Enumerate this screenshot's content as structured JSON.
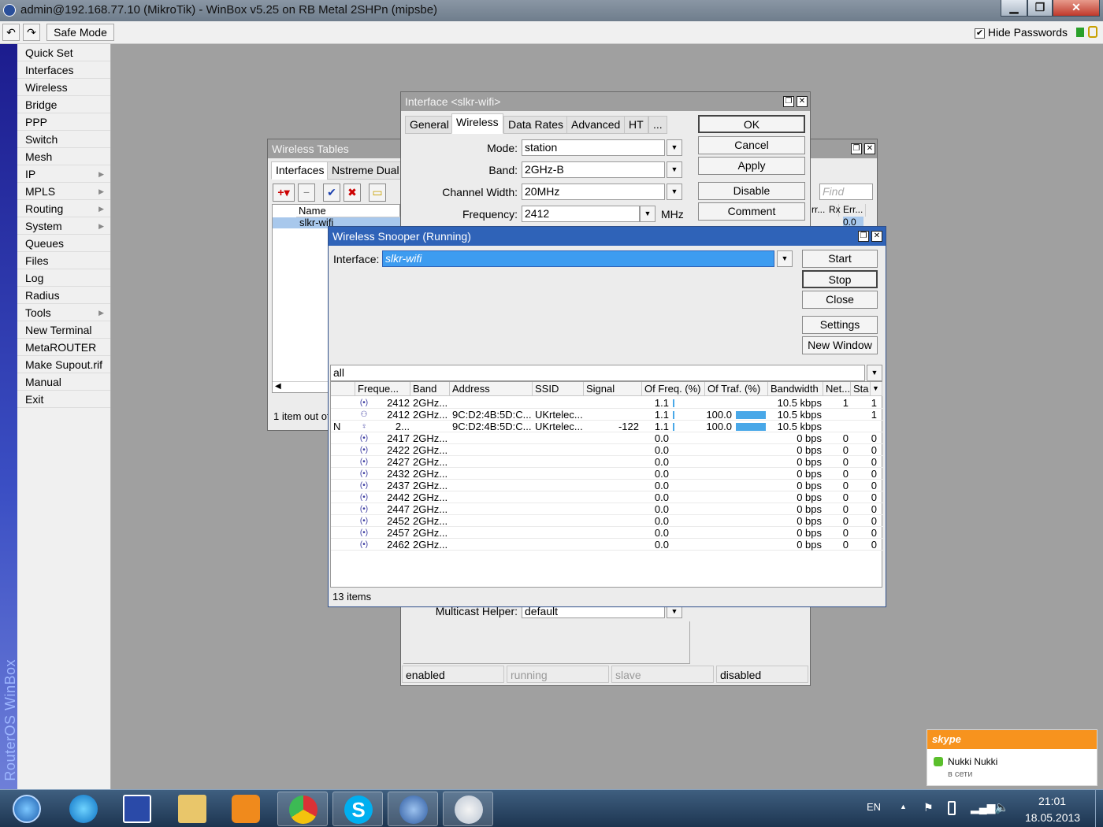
{
  "window": {
    "title": "admin@192.168.77.10 (MikroTik) - WinBox v5.25 on RB Metal 2SHPn (mipsbe)",
    "min_glyph": "▁",
    "max_glyph": "❐",
    "close_glyph": "✕"
  },
  "toolbar": {
    "undo_glyph": "↶",
    "redo_glyph": "↷",
    "safe_mode_label": "Safe Mode",
    "hide_passwords_label": "Hide Passwords",
    "hide_passwords_checked": "✔"
  },
  "sidebar": {
    "brand": "RouterOS WinBox",
    "items": [
      {
        "label": "Quick Set",
        "arrow": ""
      },
      {
        "label": "Interfaces",
        "arrow": ""
      },
      {
        "label": "Wireless",
        "arrow": ""
      },
      {
        "label": "Bridge",
        "arrow": ""
      },
      {
        "label": "PPP",
        "arrow": ""
      },
      {
        "label": "Switch",
        "arrow": ""
      },
      {
        "label": "Mesh",
        "arrow": ""
      },
      {
        "label": "IP",
        "arrow": "▶"
      },
      {
        "label": "MPLS",
        "arrow": "▶"
      },
      {
        "label": "Routing",
        "arrow": "▶"
      },
      {
        "label": "System",
        "arrow": "▶"
      },
      {
        "label": "Queues",
        "arrow": ""
      },
      {
        "label": "Files",
        "arrow": ""
      },
      {
        "label": "Log",
        "arrow": ""
      },
      {
        "label": "Radius",
        "arrow": ""
      },
      {
        "label": "Tools",
        "arrow": "▶"
      },
      {
        "label": "New Terminal",
        "arrow": ""
      },
      {
        "label": "MetaROUTER",
        "arrow": ""
      },
      {
        "label": "Make Supout.rif",
        "arrow": ""
      },
      {
        "label": "Manual",
        "arrow": ""
      },
      {
        "label": "Exit",
        "arrow": ""
      }
    ]
  },
  "wireless_tables": {
    "title": "Wireless Tables",
    "tabs": [
      "Interfaces",
      "Nstreme Dual"
    ],
    "col_name": "Name",
    "row_name": "slkr-wifi",
    "find_placeholder": "Find",
    "col_rr": "rr...",
    "col_rx_err": "Rx Err...",
    "col_value": "0.0",
    "status": "1 item out of"
  },
  "interface_dialog": {
    "title": "Interface <slkr-wifi>",
    "tabs": [
      "General",
      "Wireless",
      "Data Rates",
      "Advanced",
      "HT",
      "..."
    ],
    "active_tab": "Wireless",
    "fields": {
      "mode_label": "Mode:",
      "mode_value": "station",
      "band_label": "Band:",
      "band_value": "2GHz-B",
      "channel_width_label": "Channel Width:",
      "channel_width_value": "20MHz",
      "frequency_label": "Frequency:",
      "frequency_value": "2412",
      "frequency_unit": "MHz",
      "multicast_label": "Multicast Helper:",
      "multicast_value": "default"
    },
    "buttons": {
      "ok": "OK",
      "cancel": "Cancel",
      "apply": "Apply",
      "disable": "Disable",
      "comment": "Comment"
    },
    "status": {
      "enabled": "enabled",
      "running": "running",
      "slave": "slave",
      "disabled": "disabled"
    }
  },
  "snooper": {
    "title": "Wireless Snooper (Running)",
    "interface_label": "Interface:",
    "interface_value": "slkr-wifi",
    "filter_value": "all",
    "buttons": {
      "start": "Start",
      "stop": "Stop",
      "close": "Close",
      "settings": "Settings",
      "new_window": "New Window"
    },
    "columns": [
      "Freque...",
      "Band",
      "Address",
      "SSID",
      "Signal",
      "Of Freq. (%)",
      "Of Traf. (%)",
      "Bandwidth",
      "Net...",
      "Sta"
    ],
    "rows": [
      {
        "flag": "",
        "icon": "(•)",
        "freq": "2412",
        "band": "2GHz...",
        "address": "",
        "ssid": "",
        "signal": "",
        "of_freq": "1.1",
        "of_freq_pct": 0.011,
        "of_traf": "",
        "of_traf_pct": 0,
        "bandwidth": "10.5 kbps",
        "net": "1",
        "sta": "1"
      },
      {
        "flag": "",
        "icon": "⚇",
        "freq": "2412",
        "band": "2GHz...",
        "address": "9C:D2:4B:5D:C...",
        "ssid": "UKrtelec...",
        "signal": "",
        "of_freq": "1.1",
        "of_freq_pct": 0.011,
        "of_traf": "100.0",
        "of_traf_pct": 1.0,
        "bandwidth": "10.5 kbps",
        "net": "",
        "sta": "1"
      },
      {
        "flag": "N",
        "icon": "♀",
        "freq": "2...",
        "band": "",
        "address": "9C:D2:4B:5D:C...",
        "ssid": "UKrtelec...",
        "signal": "-122",
        "of_freq": "1.1",
        "of_freq_pct": 0.011,
        "of_traf": "100.0",
        "of_traf_pct": 1.0,
        "bandwidth": "10.5 kbps",
        "net": "",
        "sta": ""
      },
      {
        "flag": "",
        "icon": "(•)",
        "freq": "2417",
        "band": "2GHz...",
        "address": "",
        "ssid": "",
        "signal": "",
        "of_freq": "0.0",
        "of_freq_pct": 0,
        "of_traf": "",
        "of_traf_pct": 0,
        "bandwidth": "0 bps",
        "net": "0",
        "sta": "0"
      },
      {
        "flag": "",
        "icon": "(•)",
        "freq": "2422",
        "band": "2GHz...",
        "address": "",
        "ssid": "",
        "signal": "",
        "of_freq": "0.0",
        "of_freq_pct": 0,
        "of_traf": "",
        "of_traf_pct": 0,
        "bandwidth": "0 bps",
        "net": "0",
        "sta": "0"
      },
      {
        "flag": "",
        "icon": "(•)",
        "freq": "2427",
        "band": "2GHz...",
        "address": "",
        "ssid": "",
        "signal": "",
        "of_freq": "0.0",
        "of_freq_pct": 0,
        "of_traf": "",
        "of_traf_pct": 0,
        "bandwidth": "0 bps",
        "net": "0",
        "sta": "0"
      },
      {
        "flag": "",
        "icon": "(•)",
        "freq": "2432",
        "band": "2GHz...",
        "address": "",
        "ssid": "",
        "signal": "",
        "of_freq": "0.0",
        "of_freq_pct": 0,
        "of_traf": "",
        "of_traf_pct": 0,
        "bandwidth": "0 bps",
        "net": "0",
        "sta": "0"
      },
      {
        "flag": "",
        "icon": "(•)",
        "freq": "2437",
        "band": "2GHz...",
        "address": "",
        "ssid": "",
        "signal": "",
        "of_freq": "0.0",
        "of_freq_pct": 0,
        "of_traf": "",
        "of_traf_pct": 0,
        "bandwidth": "0 bps",
        "net": "0",
        "sta": "0"
      },
      {
        "flag": "",
        "icon": "(•)",
        "freq": "2442",
        "band": "2GHz...",
        "address": "",
        "ssid": "",
        "signal": "",
        "of_freq": "0.0",
        "of_freq_pct": 0,
        "of_traf": "",
        "of_traf_pct": 0,
        "bandwidth": "0 bps",
        "net": "0",
        "sta": "0"
      },
      {
        "flag": "",
        "icon": "(•)",
        "freq": "2447",
        "band": "2GHz...",
        "address": "",
        "ssid": "",
        "signal": "",
        "of_freq": "0.0",
        "of_freq_pct": 0,
        "of_traf": "",
        "of_traf_pct": 0,
        "bandwidth": "0 bps",
        "net": "0",
        "sta": "0"
      },
      {
        "flag": "",
        "icon": "(•)",
        "freq": "2452",
        "band": "2GHz...",
        "address": "",
        "ssid": "",
        "signal": "",
        "of_freq": "0.0",
        "of_freq_pct": 0,
        "of_traf": "",
        "of_traf_pct": 0,
        "bandwidth": "0 bps",
        "net": "0",
        "sta": "0"
      },
      {
        "flag": "",
        "icon": "(•)",
        "freq": "2457",
        "band": "2GHz...",
        "address": "",
        "ssid": "",
        "signal": "",
        "of_freq": "0.0",
        "of_freq_pct": 0,
        "of_traf": "",
        "of_traf_pct": 0,
        "bandwidth": "0 bps",
        "net": "0",
        "sta": "0"
      },
      {
        "flag": "",
        "icon": "(•)",
        "freq": "2462",
        "band": "2GHz...",
        "address": "",
        "ssid": "",
        "signal": "",
        "of_freq": "0.0",
        "of_freq_pct": 0,
        "of_traf": "",
        "of_traf_pct": 0,
        "bandwidth": "0 bps",
        "net": "0",
        "sta": "0"
      }
    ],
    "status": "13 items"
  },
  "skype_popup": {
    "brand": "skype",
    "name": "Nukki Nukki",
    "status": "в сети"
  },
  "taskbar": {
    "lang": "EN",
    "time": "21:01",
    "date": "18.05.2013",
    "apps": [
      "start-orb",
      "internet-explorer",
      "save-app",
      "file-explorer",
      "media-player",
      "chrome",
      "skype",
      "winbox",
      "paint"
    ]
  },
  "colors": {
    "accent": "#2f63b8",
    "selection": "#49a8e8",
    "skype_orange": "#f7931e"
  }
}
